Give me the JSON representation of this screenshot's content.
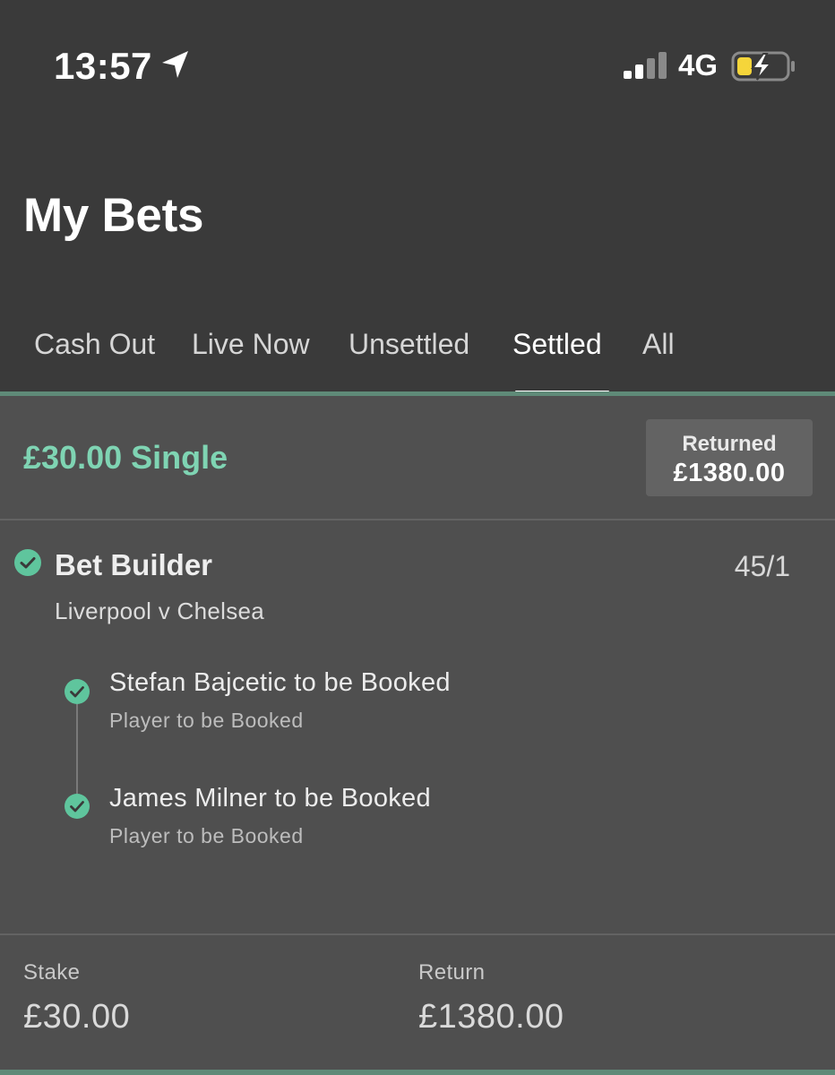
{
  "status_bar": {
    "time": "13:57",
    "network": "4G",
    "icons": [
      "location-arrow-icon",
      "cellular-signal-icon",
      "battery-charging-icon"
    ]
  },
  "page": {
    "title": "My Bets"
  },
  "tabs": [
    {
      "label": "Cash Out",
      "active": false
    },
    {
      "label": "Live Now",
      "active": false
    },
    {
      "label": "Unsettled",
      "active": false
    },
    {
      "label": "Settled",
      "active": true
    },
    {
      "label": "All",
      "active": false
    }
  ],
  "bet": {
    "type_label": "£30.00 Single",
    "returned_label": "Returned",
    "returned_value": "£1380.00",
    "selection": {
      "market": "Bet Builder",
      "odds": "45/1",
      "event": "Liverpool v Chelsea",
      "legs": [
        {
          "title": "Stefan Bajcetic to be Booked",
          "subtitle": "Player to be Booked"
        },
        {
          "title": "James Milner to be Booked",
          "subtitle": "Player to be Booked"
        }
      ]
    },
    "stake_label": "Stake",
    "stake_value": "£30.00",
    "return_label": "Return",
    "return_value": "£1380.00"
  },
  "colors": {
    "accent_green": "#7fd4b3",
    "check_green": "#5fc59d",
    "header_bg": "#3a3a3a",
    "body_bg": "#4f4f4f"
  }
}
